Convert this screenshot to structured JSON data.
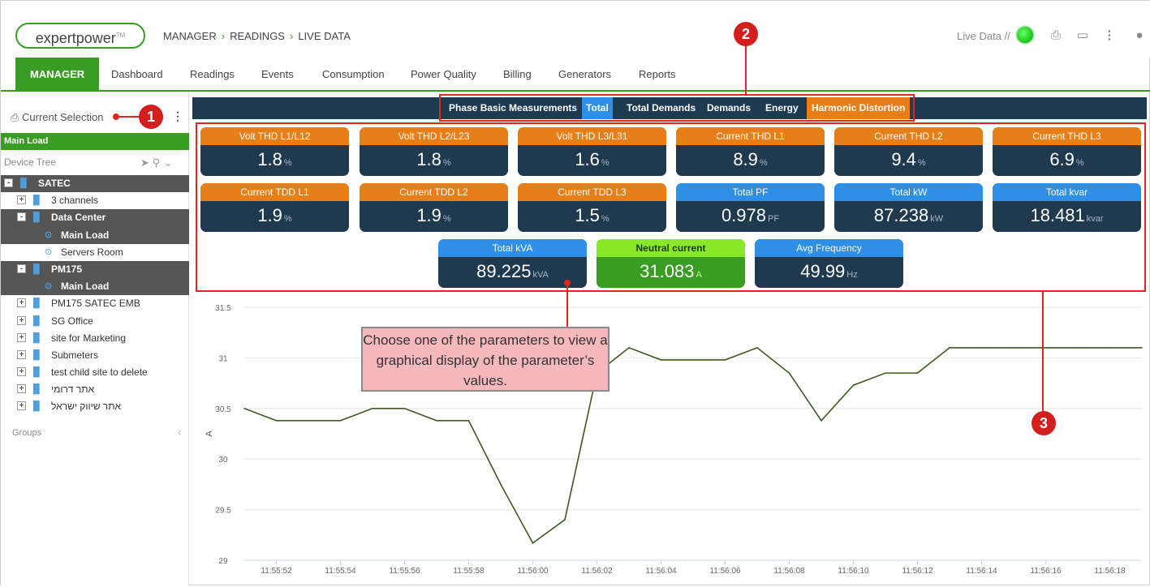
{
  "header": {
    "logo": "expertpower",
    "logo_tm": "TM",
    "breadcrumb": [
      "MANAGER",
      "READINGS",
      "LIVE DATA"
    ],
    "live_label": "Live Data //",
    "live_status_color": "#22cc22"
  },
  "nav": {
    "items": [
      "MANAGER",
      "Dashboard",
      "Readings",
      "Events",
      "Consumption",
      "Power Quality",
      "Billing",
      "Generators",
      "Reports"
    ]
  },
  "sidebar": {
    "current_selection": "Current Selection",
    "selected": "Main Load",
    "device_tree_label": "Device Tree",
    "groups_label": "Groups",
    "tree": [
      {
        "label": "SATEC",
        "toggle": "-",
        "level": 0,
        "dark": true
      },
      {
        "label": "3 channels",
        "toggle": "+",
        "level": 1,
        "dark": false
      },
      {
        "label": "Data Center",
        "toggle": "-",
        "level": 1,
        "dark": true
      },
      {
        "label": "Main Load",
        "toggle": "",
        "level": 2,
        "dark": true
      },
      {
        "label": "Servers Room",
        "toggle": "",
        "level": 2,
        "dark": false
      },
      {
        "label": "PM175",
        "toggle": "-",
        "level": 1,
        "dark": true
      },
      {
        "label": "Main Load",
        "toggle": "",
        "level": 2,
        "dark": true
      },
      {
        "label": "PM175 SATEC EMB",
        "toggle": "+",
        "level": 1,
        "dark": false
      },
      {
        "label": "SG Office",
        "toggle": "+",
        "level": 1,
        "dark": false
      },
      {
        "label": "site for Marketing",
        "toggle": "+",
        "level": 1,
        "dark": false
      },
      {
        "label": "Submeters",
        "toggle": "+",
        "level": 1,
        "dark": false
      },
      {
        "label": "test child site to delete",
        "toggle": "+",
        "level": 1,
        "dark": false
      },
      {
        "label": "אתר דרומי",
        "toggle": "+",
        "level": 1,
        "dark": false
      },
      {
        "label": "אתר שיווק ישראל",
        "toggle": "+",
        "level": 1,
        "dark": false
      }
    ]
  },
  "tabs": {
    "items": [
      "Phase Basic Measurements",
      "Total",
      "Total Demands",
      "Demands",
      "Energy",
      "Harmonic Distortion"
    ],
    "selected_blue": "Total",
    "selected_orange": "Harmonic Distortion"
  },
  "tiles": [
    {
      "label": "Volt THD L1/L12",
      "value": "1.8",
      "unit": "%",
      "color": "orange"
    },
    {
      "label": "Volt THD L2/L23",
      "value": "1.8",
      "unit": "%",
      "color": "orange"
    },
    {
      "label": "Volt THD L3/L31",
      "value": "1.6",
      "unit": "%",
      "color": "orange"
    },
    {
      "label": "Current THD L1",
      "value": "8.9",
      "unit": "%",
      "color": "orange"
    },
    {
      "label": "Current THD L2",
      "value": "9.4",
      "unit": "%",
      "color": "orange"
    },
    {
      "label": "Current THD L3",
      "value": "6.9",
      "unit": "%",
      "color": "orange"
    },
    {
      "label": "Current TDD L1",
      "value": "1.9",
      "unit": "%",
      "color": "orange"
    },
    {
      "label": "Current TDD L2",
      "value": "1.9",
      "unit": "%",
      "color": "orange"
    },
    {
      "label": "Current TDD L3",
      "value": "1.5",
      "unit": "%",
      "color": "orange"
    },
    {
      "label": "Total PF",
      "value": "0.978",
      "unit": "PF",
      "color": "blue"
    },
    {
      "label": "Total kW",
      "value": "87.238",
      "unit": "kW",
      "color": "blue"
    },
    {
      "label": "Total kvar",
      "value": "18.481",
      "unit": "kvar",
      "color": "blue"
    },
    {
      "label": "Total kVA",
      "value": "89.225",
      "unit": "kVA",
      "color": "blue"
    },
    {
      "label": "Neutral current",
      "value": "31.083",
      "unit": "A",
      "color": "green"
    },
    {
      "label": "Avg Frequency",
      "value": "49.99",
      "unit": "Hz",
      "color": "blue"
    }
  ],
  "callouts": {
    "one": "1",
    "two": "2",
    "three": "3",
    "note": "Choose one of the parameters to view a graphical display of the parameter’s values."
  },
  "colors": {
    "accent": "#3a9d23",
    "tab_bar": "#1c3a52",
    "orange": "#e77f18",
    "blue": "#2d8fe6",
    "callout_red": "#e1261c",
    "line": "#3d5a1e"
  },
  "chart_data": {
    "type": "line",
    "ylabel": "A",
    "ylim": [
      29,
      31.5
    ],
    "yticks": [
      "29",
      "29.5",
      "30",
      "30.5",
      "31",
      "31.5"
    ],
    "xticks": [
      "11:55:52",
      "11:55:54",
      "11:55:56",
      "11:55:58",
      "11:56:00",
      "11:56:02",
      "11:56:04",
      "11:56:06",
      "11:56:08",
      "11:56:10",
      "11:56:12",
      "11:56:14",
      "11:56:16",
      "11:56:18"
    ],
    "grid": true,
    "series": [
      {
        "x": [
          "11:55:51",
          "11:55:52",
          "11:55:53",
          "11:55:54",
          "11:55:55",
          "11:55:56",
          "11:55:57",
          "11:55:58",
          "11:55:59",
          "11:56:00",
          "11:56:01",
          "11:56:02",
          "11:56:03",
          "11:56:04",
          "11:56:05",
          "11:56:06",
          "11:56:07",
          "11:56:08",
          "11:56:09",
          "11:56:10",
          "11:56:11",
          "11:56:12",
          "11:56:13",
          "11:56:14",
          "11:56:15",
          "11:56:16",
          "11:56:17",
          "11:56:18",
          "11:56:19"
        ],
        "values": [
          30.5,
          30.38,
          30.38,
          30.38,
          30.5,
          30.5,
          30.38,
          30.38,
          29.75,
          29.17,
          29.4,
          30.85,
          31.1,
          30.98,
          30.98,
          30.98,
          31.1,
          30.85,
          30.38,
          30.73,
          30.85,
          30.85,
          31.1,
          31.1,
          31.1,
          31.1,
          31.1,
          31.1,
          31.1
        ]
      }
    ]
  }
}
